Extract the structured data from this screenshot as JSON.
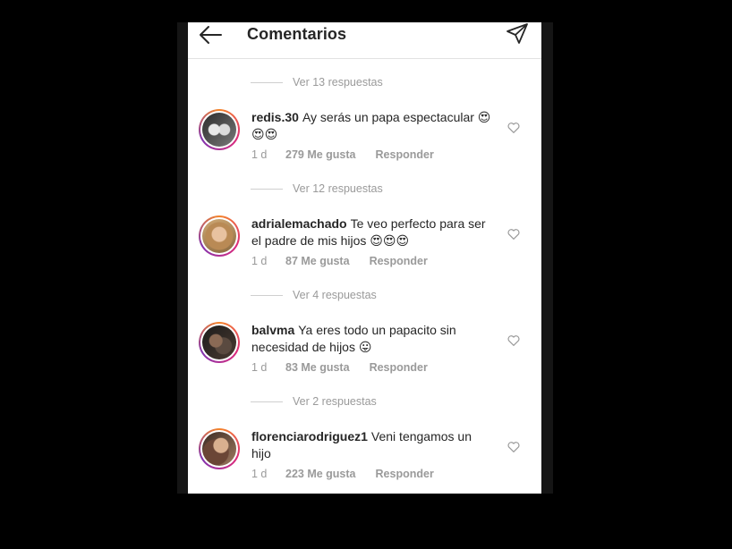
{
  "header": {
    "title": "Comentarios",
    "back_icon": "arrow-left-icon",
    "share_icon": "paper-plane-icon"
  },
  "comments": [
    {
      "replies_label": "Ver 13 respuestas",
      "username": "redis.30",
      "text": "Ay serás un papa espectacular 😍😍😍",
      "time": "1 d",
      "likes": "279 Me gusta",
      "reply": "Responder"
    },
    {
      "replies_label": "Ver 12 respuestas",
      "username": "adrialemachado",
      "text": "Te veo perfecto para ser el padre de mis hijos 😍😍😍",
      "time": "1 d",
      "likes": "87 Me gusta",
      "reply": "Responder"
    },
    {
      "replies_label": "Ver 4 respuestas",
      "username": "balvma",
      "text": "Ya eres todo un papacito sin necesidad de hijos 😛",
      "time": "1 d",
      "likes": "83 Me gusta",
      "reply": "Responder"
    },
    {
      "replies_label": "Ver 2 respuestas",
      "username": "florenciarodriguez1",
      "text": "Veni tengamos un hijo",
      "time": "1 d",
      "likes": "223 Me gusta",
      "reply": "Responder"
    }
  ],
  "colors": {
    "text": "#262626",
    "secondary": "#9a9a9a",
    "ring_start": "#f58529",
    "ring_end": "#8134af"
  }
}
